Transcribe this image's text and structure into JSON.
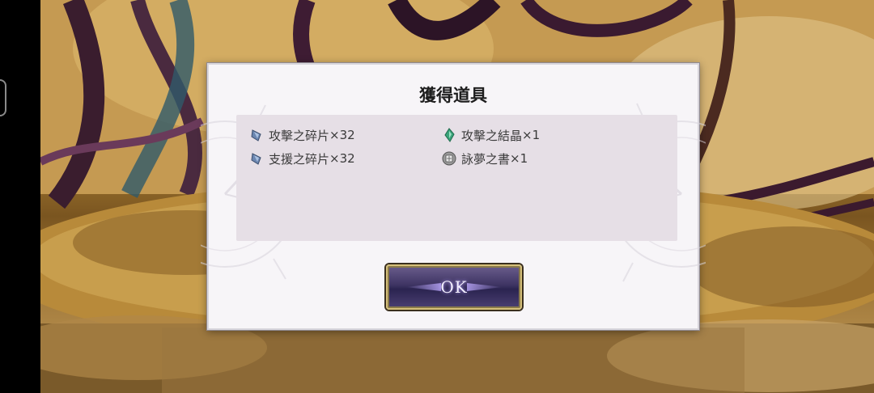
{
  "dialog": {
    "title": "獲得道具",
    "ok_label": "OK"
  },
  "items": [
    {
      "name": "攻擊之碎片",
      "qty": "×32",
      "icon": "attack-shard-icon",
      "color": "#5f7fa8"
    },
    {
      "name": "攻擊之結晶",
      "qty": "×1",
      "icon": "attack-crystal-icon",
      "color": "#3aa37a"
    },
    {
      "name": "支援之碎片",
      "qty": "×32",
      "icon": "support-shard-icon",
      "color": "#5f7fa8"
    },
    {
      "name": "詠夢之書",
      "qty": "×1",
      "icon": "dream-book-icon",
      "color": "#7a7a7a"
    }
  ],
  "colors": {
    "dialog_bg": "#f7f5f8",
    "panel_bg": "#e6dfe6",
    "button_border": "#d6c07a",
    "button_bg": "#3e3463"
  }
}
